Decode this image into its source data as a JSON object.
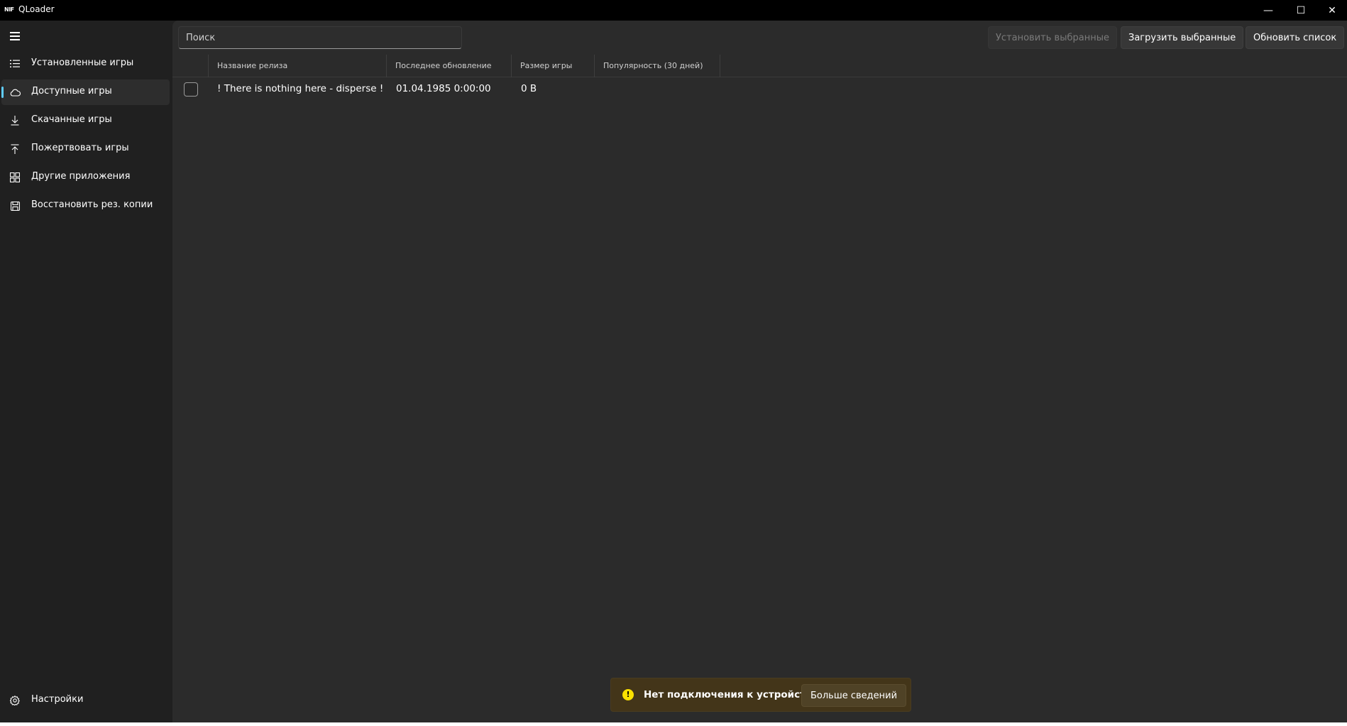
{
  "window": {
    "logo_text": "NIF",
    "title": "QLoader",
    "minimize_glyph": "—",
    "maximize_glyph": "☐",
    "close_glyph": "✕"
  },
  "sidebar": {
    "items": [
      {
        "label": "Установленные игры",
        "icon": "list-icon"
      },
      {
        "label": "Доступные игры",
        "icon": "cloud-icon",
        "active": true
      },
      {
        "label": "Скачанные игры",
        "icon": "download-icon"
      },
      {
        "label": "Пожертвовать игры",
        "icon": "upload-icon"
      },
      {
        "label": "Другие приложения",
        "icon": "apps-icon"
      },
      {
        "label": "Восстановить рез. копии",
        "icon": "save-icon"
      }
    ],
    "settings_label": "Настройки",
    "accent_color": "#60cdff"
  },
  "toolbar": {
    "search_placeholder": "Поиск",
    "install_selected": "Установить выбранные",
    "download_selected": "Загрузить выбранные",
    "refresh_list": "Обновить список"
  },
  "table": {
    "columns": [
      "Название релиза",
      "Последнее обновление",
      "Размер игры",
      "Популярность (30 дней)"
    ],
    "rows": [
      {
        "name": "! There is nothing here - disperse !",
        "updated": "01.04.1985 0:00:00",
        "size": "0 B",
        "popularity": ""
      }
    ]
  },
  "infobar": {
    "message": "Нет подключения к устройству",
    "button": "Больше сведений",
    "icon_glyph": "!",
    "warning_color": "#fce100"
  }
}
